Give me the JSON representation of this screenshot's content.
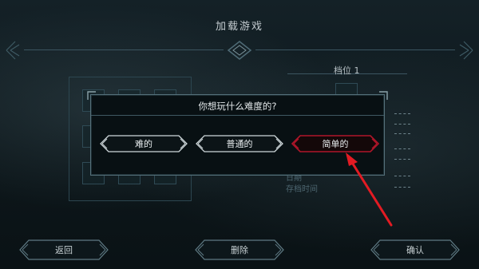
{
  "header": {
    "title": "加载游戏"
  },
  "slot": {
    "label": "档位 1"
  },
  "save_info": {
    "date_label": "日期",
    "time_label": "存档时间"
  },
  "dialog": {
    "question": "你想玩什么难度的?",
    "options": [
      {
        "label": "难的"
      },
      {
        "label": "普通的"
      },
      {
        "label": "简单的",
        "selected": true
      }
    ]
  },
  "footer": {
    "back_label": "返回",
    "delete_label": "删除",
    "confirm_label": "确认"
  },
  "colors": {
    "selected_accent": "#b0162a",
    "annotation_arrow": "#e31b23"
  }
}
